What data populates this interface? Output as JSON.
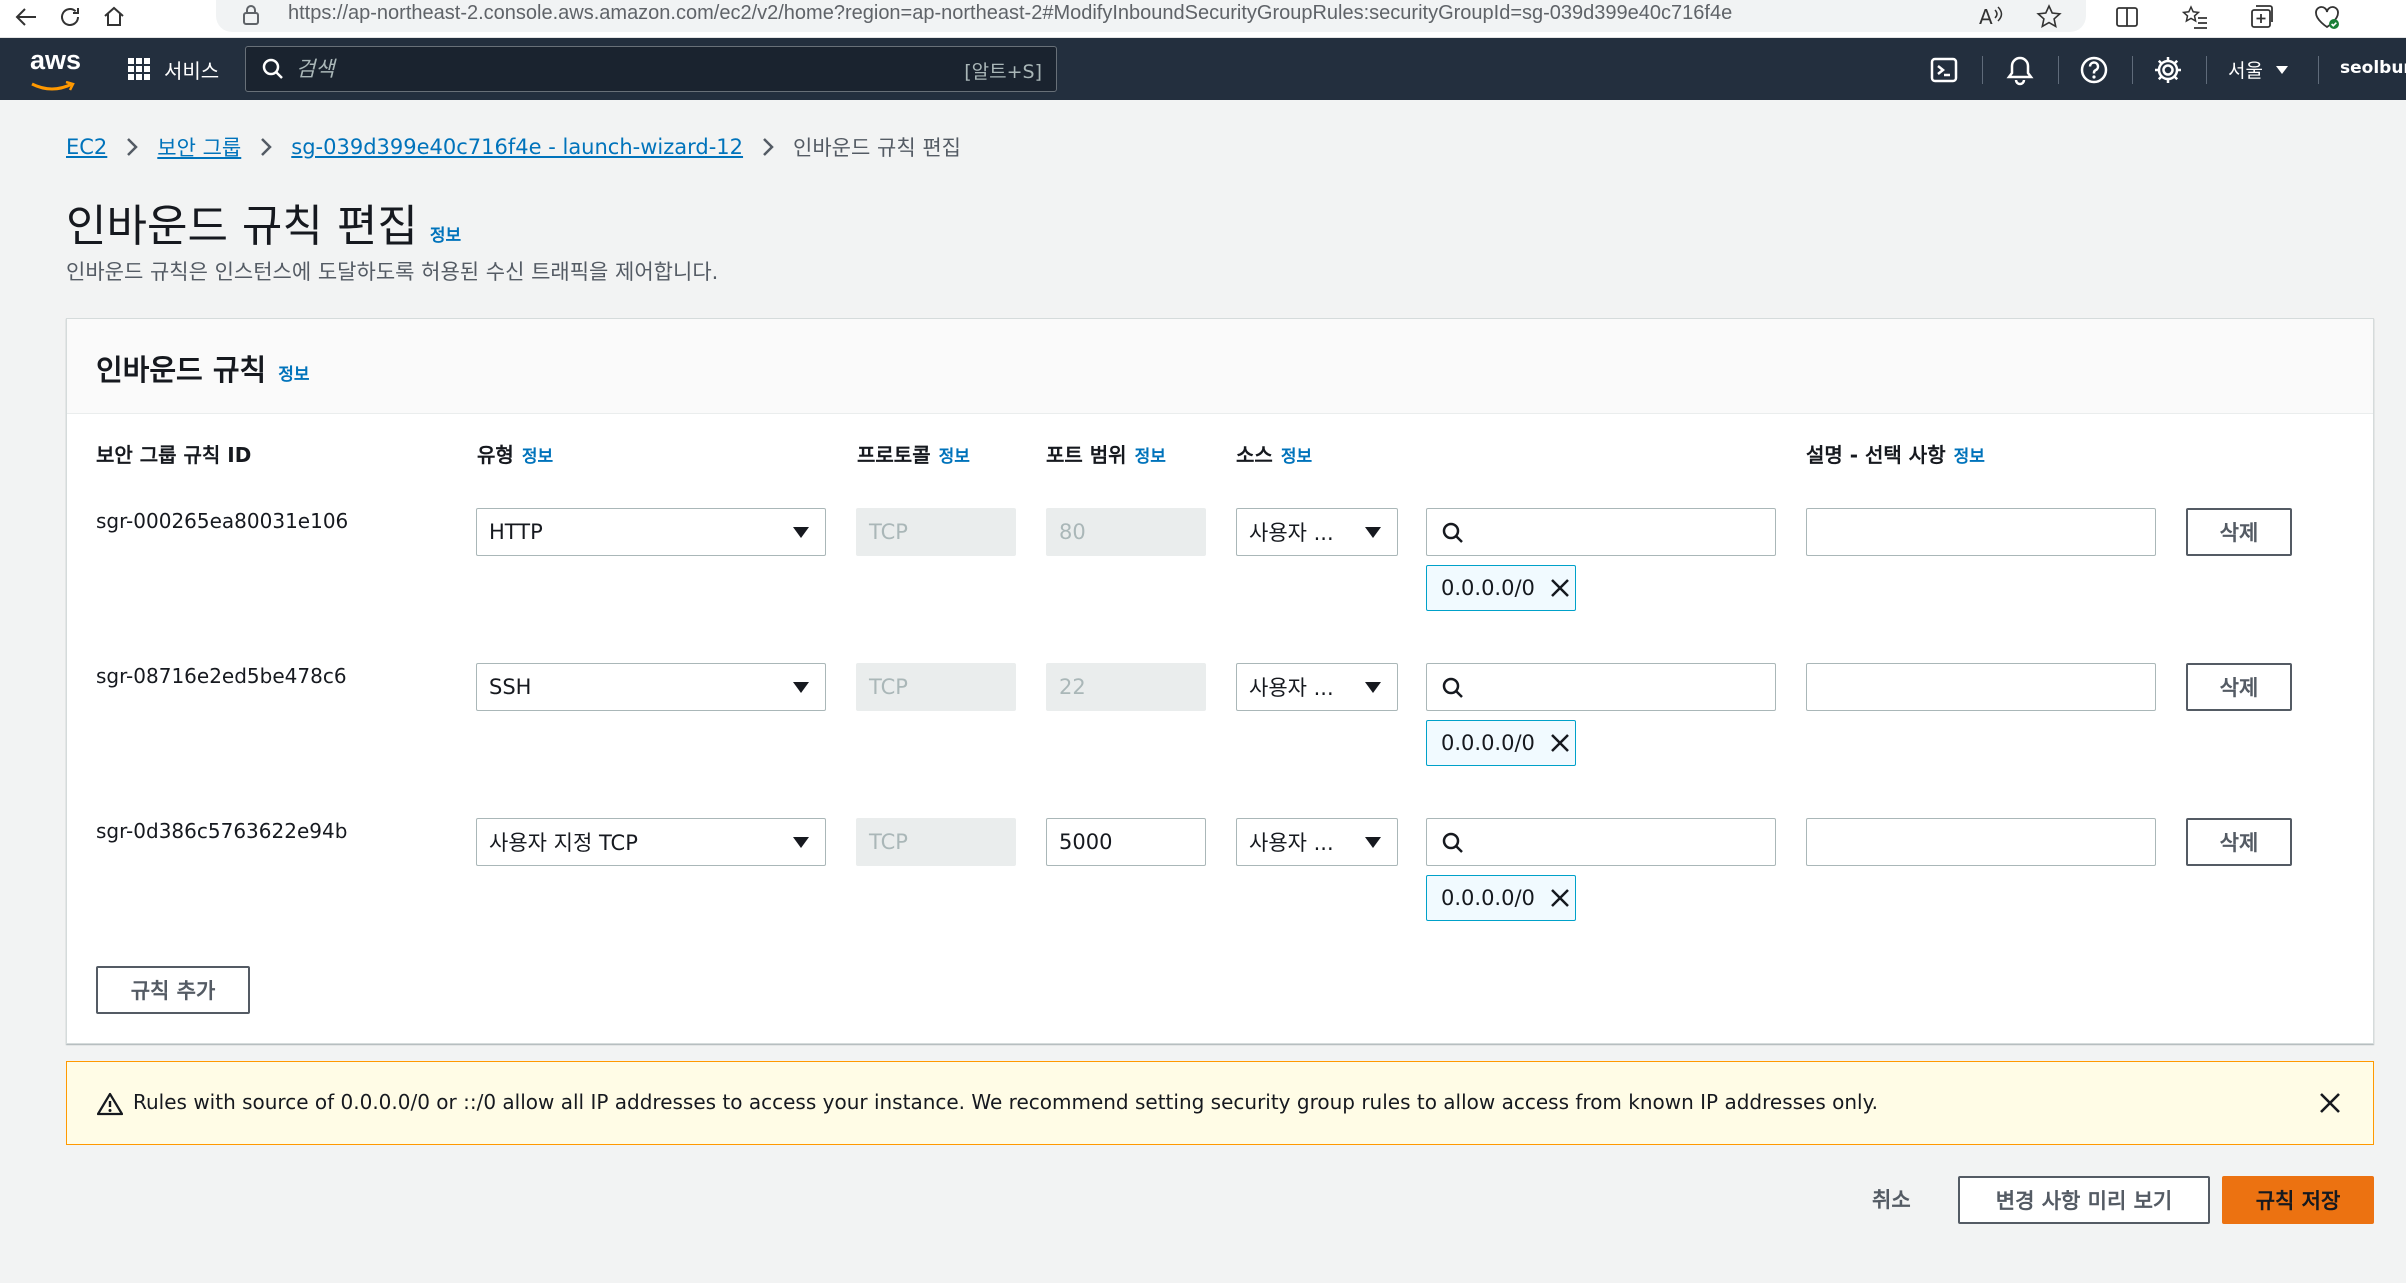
{
  "browser": {
    "url": "https://ap-northeast-2.console.aws.amazon.com/ec2/v2/home?region=ap-northeast-2#ModifyInboundSecurityGroupRules:securityGroupId=sg-039d399e40c716f4e"
  },
  "nav": {
    "logo": "aws",
    "services_label": "서비스",
    "search_placeholder": "검색",
    "search_shortcut": "[알트+S]",
    "region": "서울",
    "user": "seolbum"
  },
  "breadcrumb": {
    "items": [
      "EC2",
      "보안 그룹",
      "sg-039d399e40c716f4e - launch-wizard-12"
    ],
    "current": "인바운드 규칙 편집"
  },
  "page": {
    "title": "인바운드 규칙 편집",
    "info": "정보",
    "subtitle": "인바운드 규칙은 인스턴스에 도달하도록 허용된 수신 트래픽을 제어합니다."
  },
  "panel": {
    "title": "인바운드 규칙",
    "columns": {
      "rule_id": "보안 그룹 규칙 ID",
      "type": "유형",
      "protocol": "프로토콜",
      "port": "포트 범위",
      "source": "소스",
      "description": "설명 - 선택 사항"
    },
    "rules": [
      {
        "id": "sgr-000265ea80031e106",
        "type": "HTTP",
        "protocol": "TCP",
        "port": "80",
        "source_type": "사용자 ...",
        "cidr": "0.0.0.0/0",
        "delete": "삭제"
      },
      {
        "id": "sgr-08716e2ed5be478c6",
        "type": "SSH",
        "protocol": "TCP",
        "port": "22",
        "source_type": "사용자 ...",
        "cidr": "0.0.0.0/0",
        "delete": "삭제"
      },
      {
        "id": "sgr-0d386c5763622e94b",
        "type": "사용자 지정 TCP",
        "protocol": "TCP",
        "port": "5000",
        "source_type": "사용자 ...",
        "cidr": "0.0.0.0/0",
        "delete": "삭제"
      }
    ],
    "add_rule": "규칙 추가"
  },
  "warning": {
    "message": "Rules with source of 0.0.0.0/0 or ::/0 allow all IP addresses to access your instance. We recommend setting security group rules to allow access from known IP addresses only."
  },
  "footer": {
    "cancel": "취소",
    "preview": "변경 사항 미리 보기",
    "save": "규칙 저장"
  },
  "colors": {
    "nav_bg": "#232f3e",
    "link": "#0073bb",
    "primary": "#ec7211",
    "warning_border": "#ff9900",
    "token_border": "#00a1c9"
  }
}
